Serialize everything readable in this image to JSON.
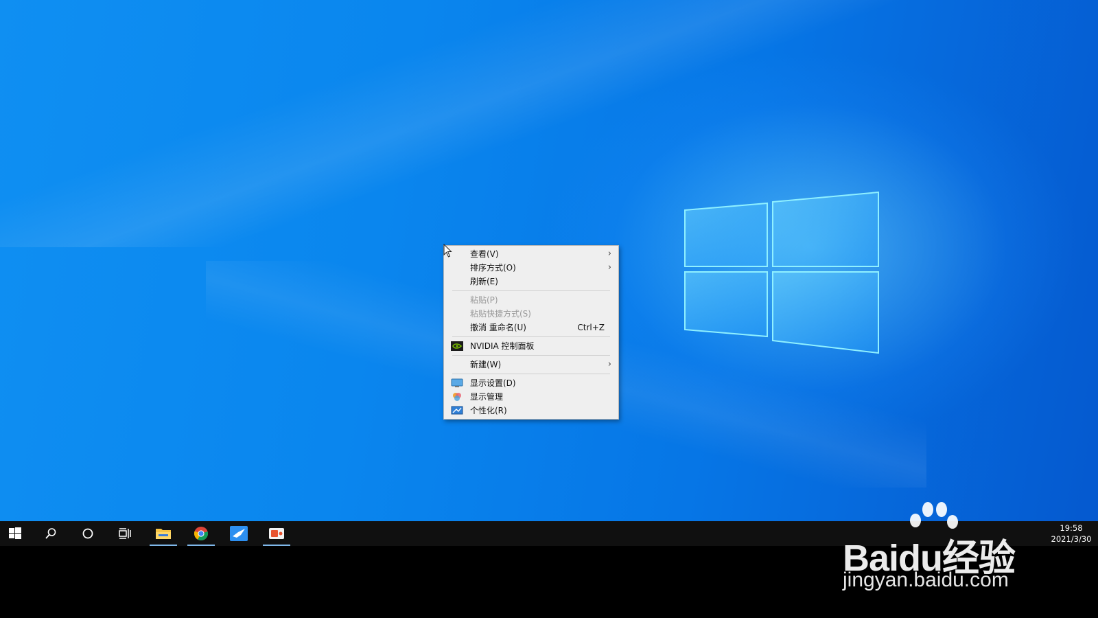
{
  "desktop": {
    "context_menu": {
      "items": [
        {
          "label": "查看(V)"
        },
        {
          "label": "排序方式(O)"
        },
        {
          "label": "刷新(E)"
        },
        {
          "label": "粘贴(P)"
        },
        {
          "label": "粘贴快捷方式(S)"
        },
        {
          "label": "撤消 重命名(U)",
          "shortcut": "Ctrl+Z"
        },
        {
          "label": "NVIDIA 控制面板"
        },
        {
          "label": "新建(W)"
        },
        {
          "label": "显示设置(D)"
        },
        {
          "label": "显示管理"
        },
        {
          "label": "个性化(R)"
        }
      ]
    }
  },
  "taskbar": {
    "clock": {
      "time": "19:58",
      "date": "2021/3/30"
    }
  },
  "watermark": {
    "brand": "Baidu经验",
    "url": "jingyan.baidu.com"
  },
  "colors": {
    "desktop_blue": "#0a86ee",
    "menu_bg": "#efefef",
    "taskbar_bg": "#101010",
    "active_indicator": "#7fb8ea"
  }
}
